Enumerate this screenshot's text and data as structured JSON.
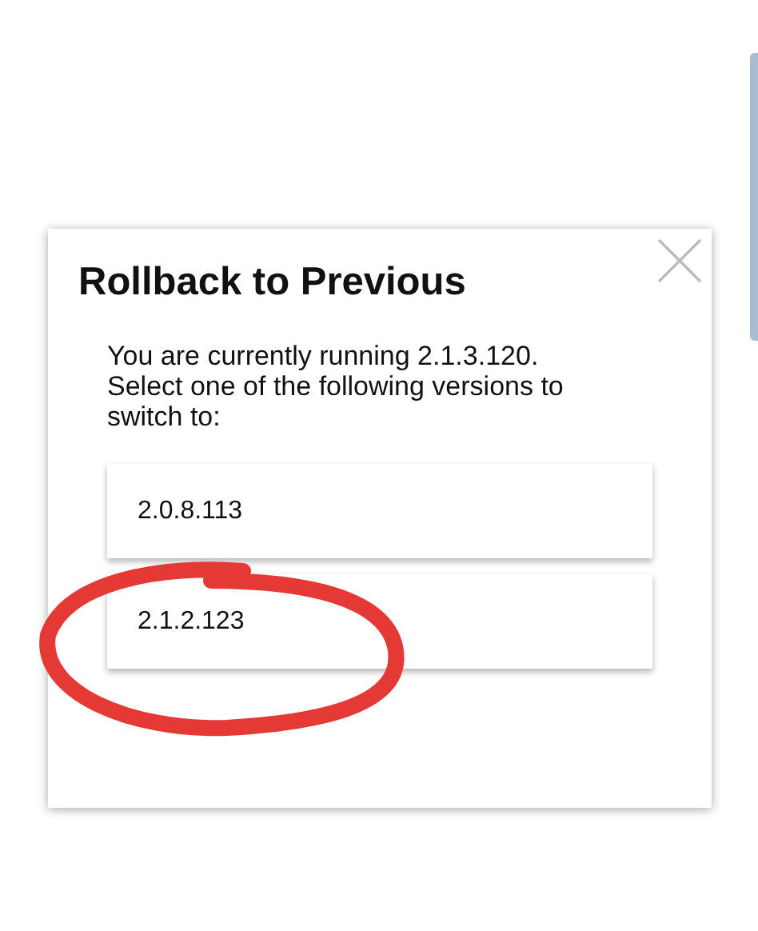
{
  "dialog": {
    "title": "Rollback to Previous",
    "message": "You are currently running 2.1.3.120. Select one of the following versions to switch to:",
    "versions": [
      {
        "label": "2.0.8.113",
        "circled": false
      },
      {
        "label": "2.1.2.123",
        "circled": true
      }
    ]
  }
}
